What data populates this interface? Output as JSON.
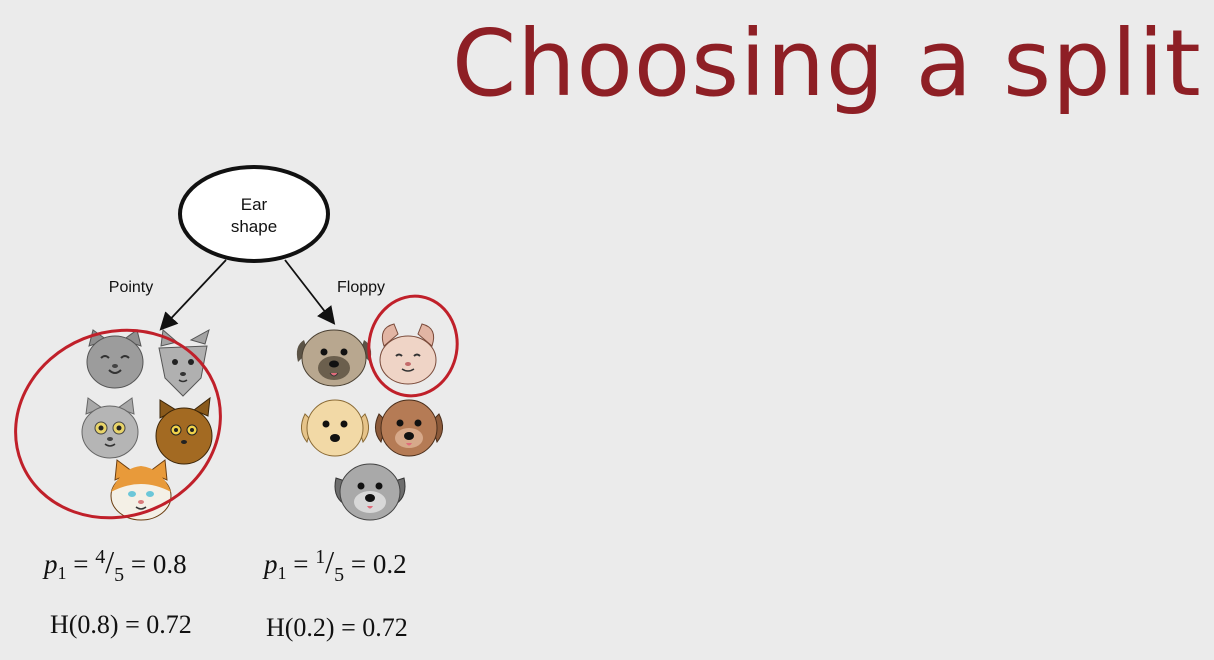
{
  "slide": {
    "title": "Choosing a split"
  },
  "tree": {
    "root": {
      "line1": "Ear",
      "line2": "shape"
    },
    "branches": [
      {
        "label": "Pointy"
      },
      {
        "label": "Floppy"
      }
    ]
  },
  "left_stats": {
    "p_label": "p",
    "p_index": "1",
    "eq": " = ",
    "num": "4",
    "slash": "/",
    "den": "5",
    "result": " = 0.8",
    "entropy": "H(0.8) = 0.72"
  },
  "right_stats": {
    "p_label": "p",
    "p_index": "1",
    "eq": " = ",
    "num": "1",
    "slash": "/",
    "den": "5",
    "result": " = 0.2",
    "entropy": "H(0.2) = 0.72"
  },
  "colors": {
    "title": "#8e1f25",
    "circle": "#c0202a",
    "background": "#ebebeb"
  },
  "icons": {
    "left_node": [
      "cat-icon",
      "cat-icon",
      "cat-icon",
      "cat-icon",
      "cat-icon"
    ],
    "right_node": [
      "dog-icon",
      "cat-icon",
      "dog-icon",
      "dog-icon",
      "dog-icon"
    ]
  }
}
